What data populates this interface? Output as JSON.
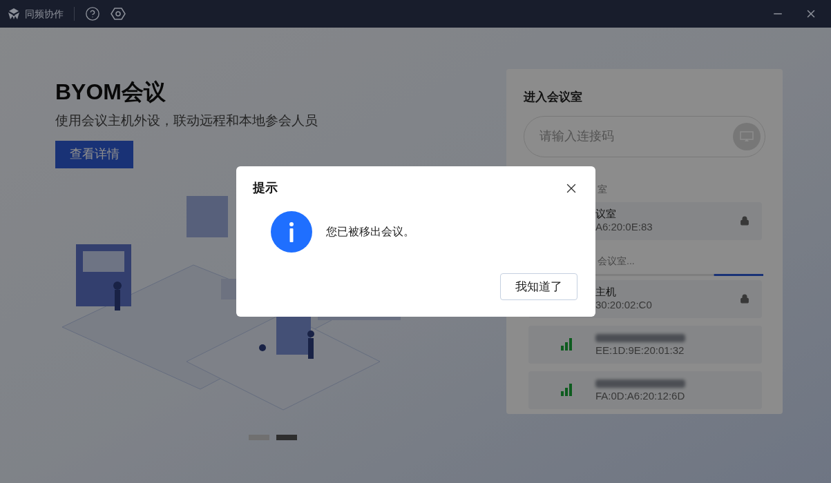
{
  "titlebar": {
    "app_name": "同频协作"
  },
  "hero": {
    "title": "BYOM会议",
    "subtitle": "使用会议主机外设，联动远程和本地参会人员",
    "button": "查看详情"
  },
  "carousel_dots": [
    {
      "selected": false
    },
    {
      "selected": true
    }
  ],
  "join_panel": {
    "title": "进入会议室",
    "input": {
      "placeholder": "请输入连接码"
    },
    "recent_label": "室",
    "recent_rooms": [
      {
        "name": "议室",
        "address": "A6:20:0E:83",
        "locked": true,
        "name_blurred": false
      }
    ],
    "search_label": "会议室...",
    "search_progress": {
      "level": 0.21
    },
    "found_rooms": [
      {
        "name": "主机",
        "address": "30:20:02:C0",
        "locked": true,
        "name_blurred": false
      },
      {
        "address": "EE:1D:9E:20:01:32",
        "locked": false,
        "name_blurred": true
      },
      {
        "address": "FA:0D:A6:20:12:6D",
        "locked": false,
        "name_blurred": true
      }
    ]
  },
  "dialog": {
    "title": "提示",
    "message": "您已被移出会议。",
    "button": "我知道了"
  }
}
